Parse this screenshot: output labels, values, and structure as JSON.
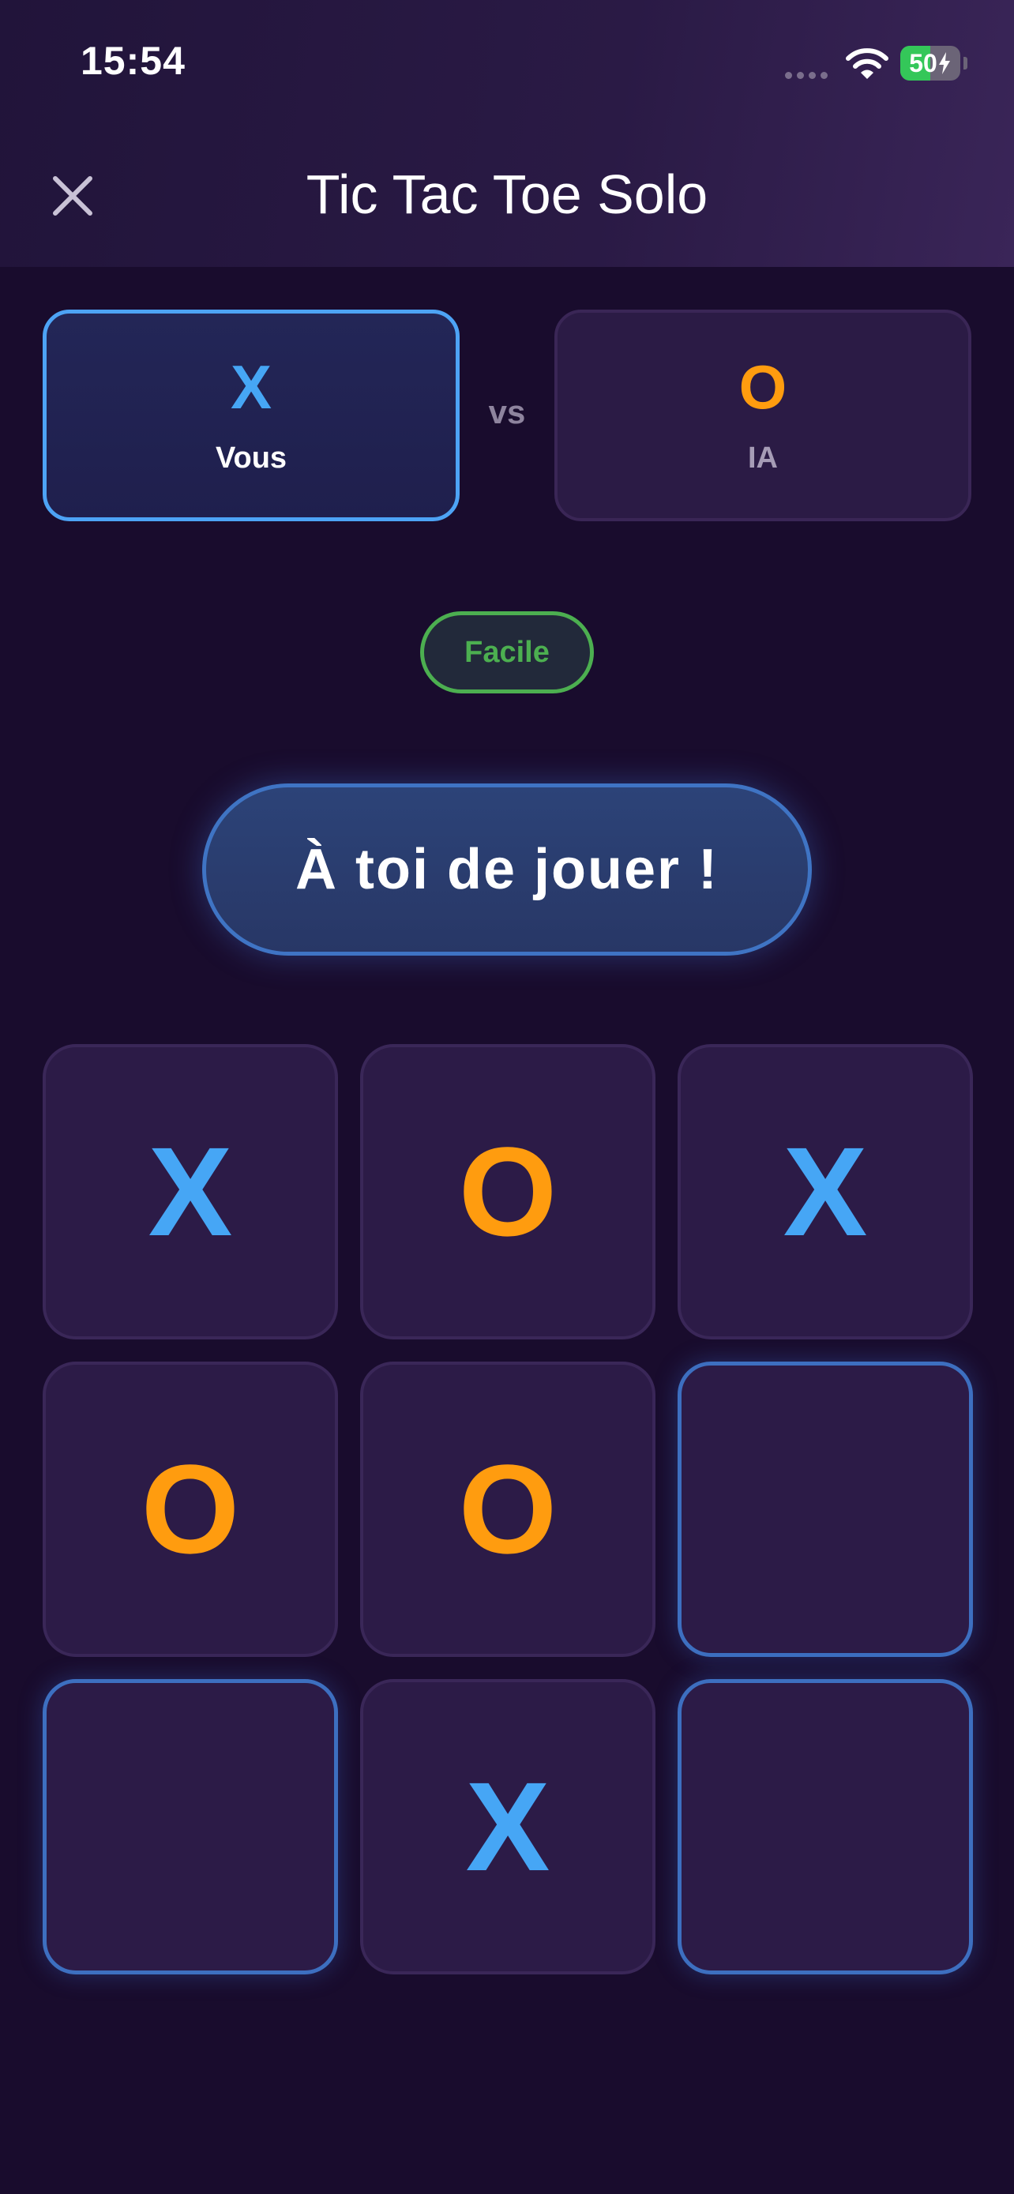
{
  "status_bar": {
    "time": "15:54",
    "battery_percent": 50,
    "battery_label": "50"
  },
  "header": {
    "title": "Tic Tac Toe Solo",
    "close_icon": "close-icon"
  },
  "players": {
    "you": {
      "mark": "X",
      "name": "Vous"
    },
    "vs_label": "vs",
    "ai": {
      "mark": "O",
      "name": "IA"
    }
  },
  "difficulty": {
    "label": "Facile"
  },
  "turn_message": "À toi de jouer !",
  "colors": {
    "x": "#46a6f5",
    "o": "#ff9c0f",
    "accent": "#4da3f5",
    "difficulty": "#4caf50",
    "background": "#190c2d"
  },
  "board": {
    "cells": [
      "X",
      "O",
      "X",
      "O",
      "O",
      "",
      "",
      "X",
      ""
    ]
  }
}
